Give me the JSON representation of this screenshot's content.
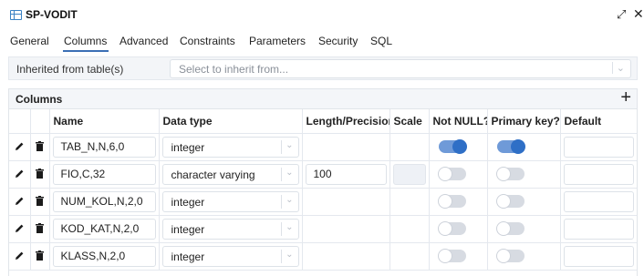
{
  "window": {
    "title": "SP-VODIT",
    "expand_glyph": "⤢",
    "close_glyph": "✕"
  },
  "tabs": [
    {
      "label": "General",
      "active": false
    },
    {
      "label": "Columns",
      "active": true
    },
    {
      "label": "Advanced",
      "active": false
    },
    {
      "label": "Constraints",
      "active": false
    },
    {
      "label": "Parameters",
      "active": false
    },
    {
      "label": "Security",
      "active": false
    },
    {
      "label": "SQL",
      "active": false
    }
  ],
  "inherit": {
    "label": "Inherited from table(s)",
    "placeholder": "Select to inherit from..."
  },
  "columns": {
    "title": "Columns",
    "add_glyph": "+",
    "headers": [
      "Name",
      "Data type",
      "Length/Precision",
      "Scale",
      "Not NULL?",
      "Primary key?",
      "Default"
    ],
    "rows": [
      {
        "name": "TAB_N,N,6,0",
        "type": "integer",
        "length": "",
        "scale": "",
        "length_enabled": false,
        "not_null": true,
        "primary_key": true,
        "default": ""
      },
      {
        "name": "FIO,C,32",
        "type": "character varying",
        "length": "100",
        "scale": "",
        "length_enabled": true,
        "not_null": false,
        "primary_key": false,
        "default": ""
      },
      {
        "name": "NUM_KOL,N,2,0",
        "type": "integer",
        "length": "",
        "scale": "",
        "length_enabled": false,
        "not_null": false,
        "primary_key": false,
        "default": ""
      },
      {
        "name": "KOD_KAT,N,2,0",
        "type": "integer",
        "length": "",
        "scale": "",
        "length_enabled": false,
        "not_null": false,
        "primary_key": false,
        "default": ""
      },
      {
        "name": "KLASS,N,2,0",
        "type": "integer",
        "length": "",
        "scale": "",
        "length_enabled": false,
        "not_null": false,
        "primary_key": false,
        "default": ""
      }
    ]
  },
  "colors": {
    "accent": "#2f6fc6",
    "toggle_on_track": "#6f9ad8",
    "toggle_off_track": "#d7dbe2"
  }
}
